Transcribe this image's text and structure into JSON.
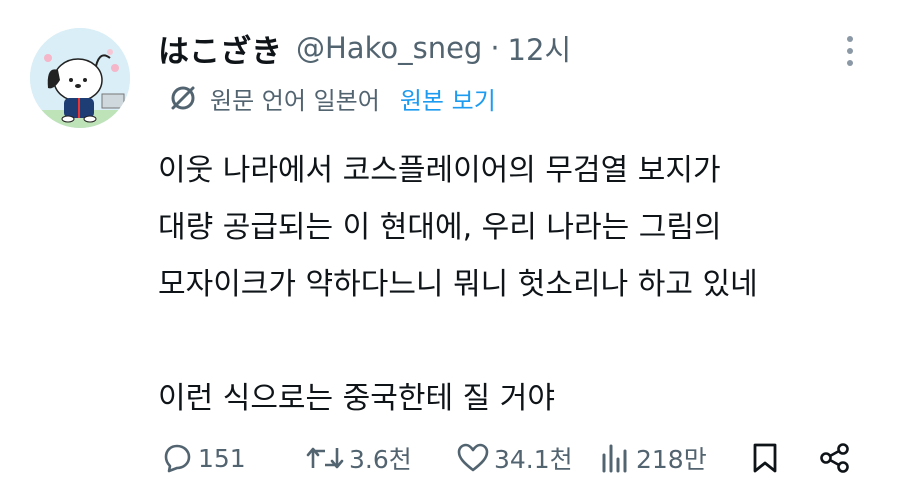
{
  "user": {
    "display_name": "はこざき",
    "handle": "@Hako_sneg",
    "separator": "·",
    "time": "12시"
  },
  "translation": {
    "source_label": "원문 언어 일본어",
    "show_original": "원본 보기"
  },
  "tweet": {
    "lines": [
      "이웃 나라에서 코스플레이어의 무검열 보지가",
      "대량 공급되는 이 현대에, 우리 나라는 그림의",
      "모자이크가 약하다느니 뭐니 헛소리나 하고 있네",
      "",
      "이런 식으로는 중국한테 질 거야"
    ]
  },
  "actions": {
    "replies": "151",
    "retweets": "3.6천",
    "likes": "34.1천",
    "views": "218만"
  },
  "colors": {
    "text": "#0f1419",
    "secondary": "#536471",
    "link": "#1d9bf0",
    "avatar_bg": "#d9eef6"
  },
  "icons": [
    "pochacco-avatar",
    "translate-icon",
    "more-icon",
    "reply-icon",
    "retweet-icon",
    "like-icon",
    "views-icon",
    "bookmark-icon",
    "share-icon"
  ]
}
